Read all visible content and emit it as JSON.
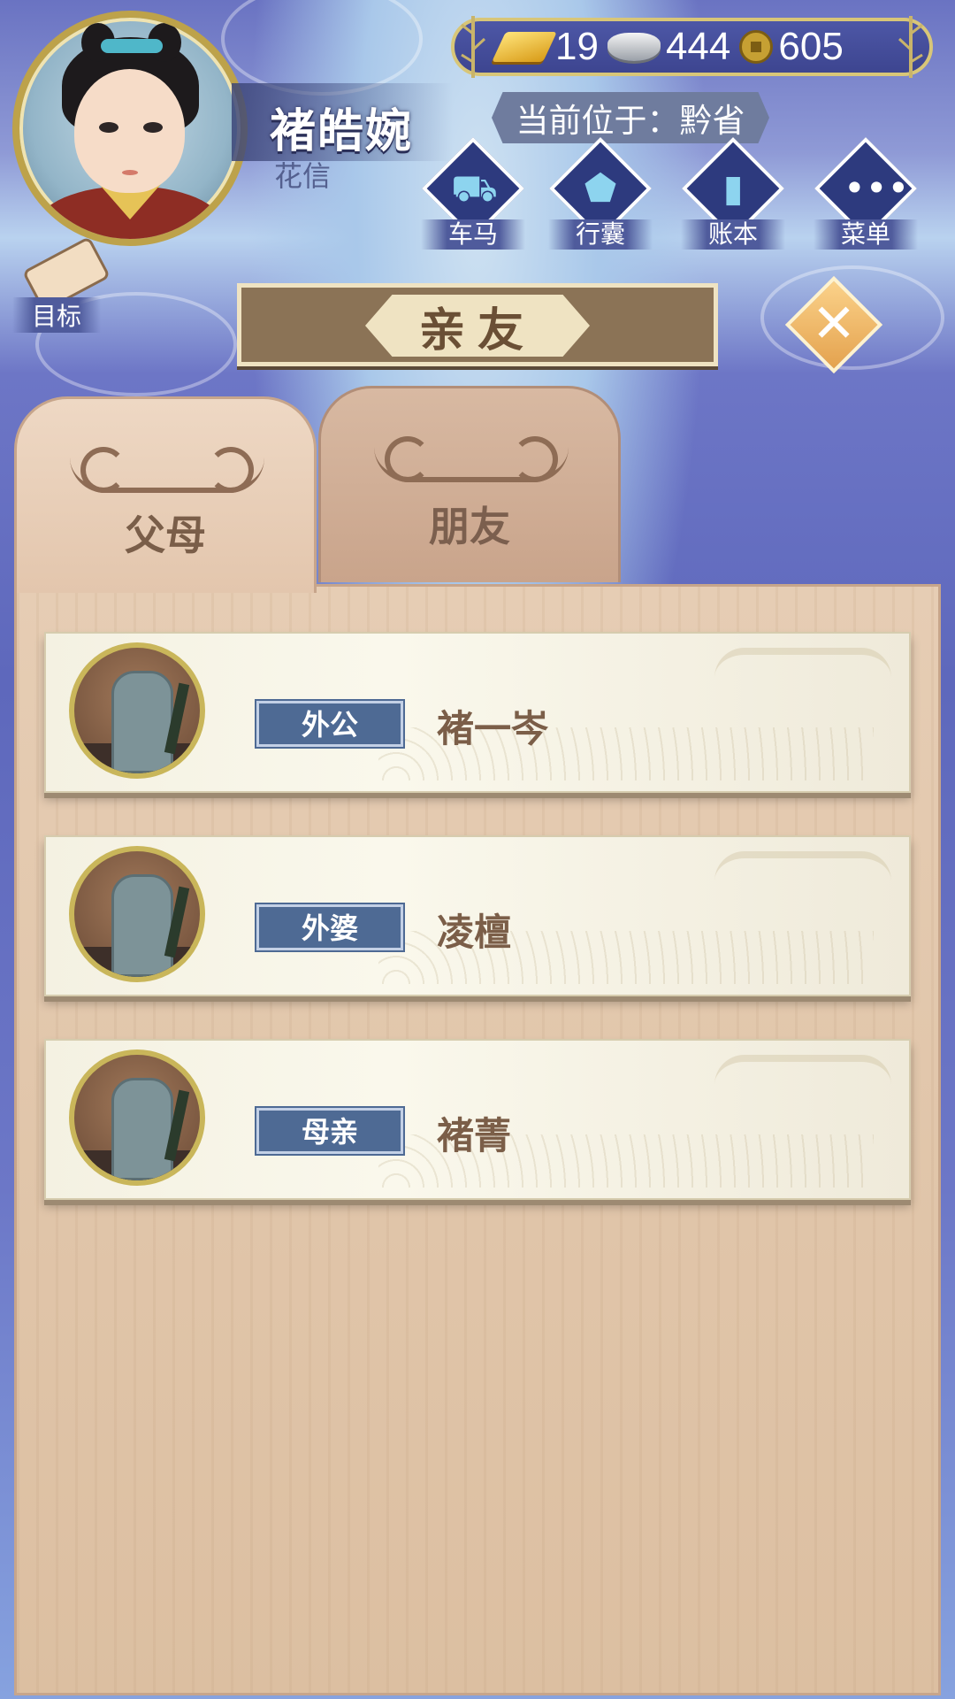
{
  "player": {
    "name": "褚皓婉",
    "subtitle": "花信"
  },
  "currency": {
    "gold": "19",
    "silver": "444",
    "copper": "605"
  },
  "location": "当前位于：黔省",
  "quick_menu": [
    {
      "label": "车马",
      "icon": "carriage-icon"
    },
    {
      "label": "行囊",
      "icon": "bag-icon"
    },
    {
      "label": "账本",
      "icon": "ledger-icon"
    },
    {
      "label": "菜单",
      "icon": "more-icon"
    }
  ],
  "goal_label": "目标",
  "title": "亲友",
  "tabs": [
    {
      "label": "父母",
      "active": true
    },
    {
      "label": "朋友",
      "active": false
    }
  ],
  "relatives": [
    {
      "relation": "外公",
      "name": "褚一岑"
    },
    {
      "relation": "外婆",
      "name": "凌檀"
    },
    {
      "relation": "母亲",
      "name": "褚菁"
    }
  ]
}
